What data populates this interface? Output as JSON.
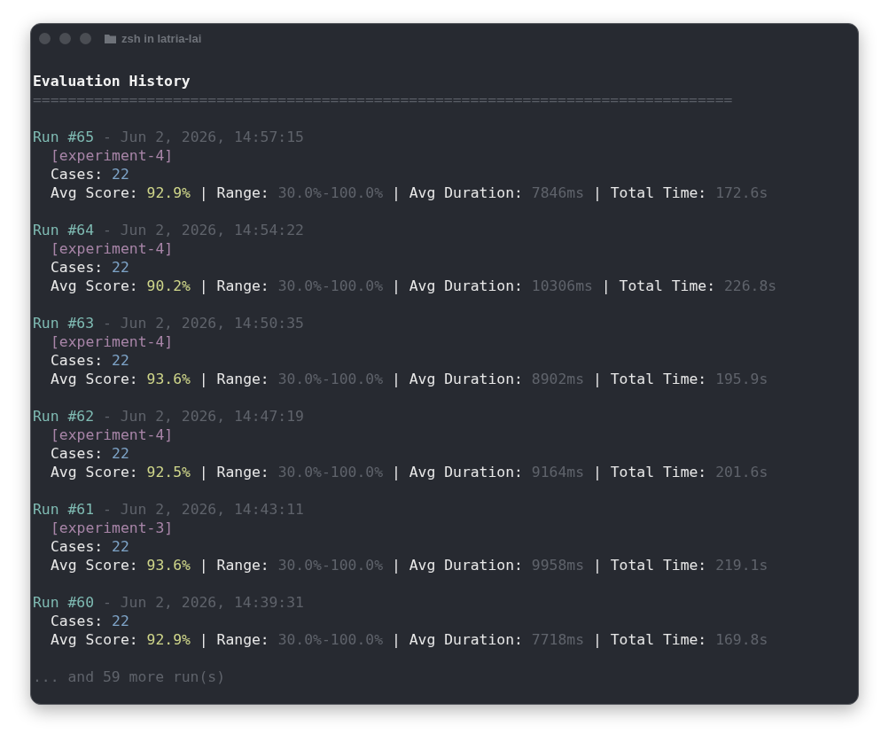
{
  "window": {
    "title": "zsh in latria-lai"
  },
  "heading": "Evaluation History",
  "rule": "================================================================================",
  "runs": [
    {
      "run": "Run #65",
      "timestamp": "- Jun 2, 2026, 14:57:15",
      "tag": "[experiment-4]",
      "cases_label": "Cases:",
      "cases": "22",
      "stats": [
        {
          "label": "Avg Score:",
          "value": "92.9%",
          "kind": "score"
        },
        {
          "sep": "|",
          "label": "Range:",
          "value": "30.0%-100.0%",
          "kind": "muted"
        },
        {
          "sep": "|",
          "label": "Avg Duration:",
          "value": "7846ms",
          "kind": "muted"
        },
        {
          "sep": "|",
          "label": "Total Time:",
          "value": "172.6s",
          "kind": "muted"
        }
      ]
    },
    {
      "run": "Run #64",
      "timestamp": "- Jun 2, 2026, 14:54:22",
      "tag": "[experiment-4]",
      "cases_label": "Cases:",
      "cases": "22",
      "stats": [
        {
          "label": "Avg Score:",
          "value": "90.2%",
          "kind": "score"
        },
        {
          "sep": "|",
          "label": "Range:",
          "value": "30.0%-100.0%",
          "kind": "muted"
        },
        {
          "sep": "|",
          "label": "Avg Duration:",
          "value": "10306ms",
          "kind": "muted"
        },
        {
          "sep": "|",
          "label": "Total Time:",
          "value": "226.8s",
          "kind": "muted"
        }
      ]
    },
    {
      "run": "Run #63",
      "timestamp": "- Jun 2, 2026, 14:50:35",
      "tag": "[experiment-4]",
      "cases_label": "Cases:",
      "cases": "22",
      "stats": [
        {
          "label": "Avg Score:",
          "value": "93.6%",
          "kind": "score"
        },
        {
          "sep": "|",
          "label": "Range:",
          "value": "30.0%-100.0%",
          "kind": "muted"
        },
        {
          "sep": "|",
          "label": "Avg Duration:",
          "value": "8902ms",
          "kind": "muted"
        },
        {
          "sep": "|",
          "label": "Total Time:",
          "value": "195.9s",
          "kind": "muted"
        }
      ]
    },
    {
      "run": "Run #62",
      "timestamp": "- Jun 2, 2026, 14:47:19",
      "tag": "[experiment-4]",
      "cases_label": "Cases:",
      "cases": "22",
      "stats": [
        {
          "label": "Avg Score:",
          "value": "92.5%",
          "kind": "score"
        },
        {
          "sep": "|",
          "label": "Range:",
          "value": "30.0%-100.0%",
          "kind": "muted"
        },
        {
          "sep": "|",
          "label": "Avg Duration:",
          "value": "9164ms",
          "kind": "muted"
        },
        {
          "sep": "|",
          "label": "Total Time:",
          "value": "201.6s",
          "kind": "muted"
        }
      ]
    },
    {
      "run": "Run #61",
      "timestamp": "- Jun 2, 2026, 14:43:11",
      "tag": "[experiment-3]",
      "cases_label": "Cases:",
      "cases": "22",
      "stats": [
        {
          "label": "Avg Score:",
          "value": "93.6%",
          "kind": "score"
        },
        {
          "sep": "|",
          "label": "Range:",
          "value": "30.0%-100.0%",
          "kind": "muted"
        },
        {
          "sep": "|",
          "label": "Avg Duration:",
          "value": "9958ms",
          "kind": "muted"
        },
        {
          "sep": "|",
          "label": "Total Time:",
          "value": "219.1s",
          "kind": "muted"
        }
      ]
    },
    {
      "run": "Run #60",
      "timestamp": "- Jun 2, 2026, 14:39:31",
      "cases_label": "Cases:",
      "cases": "22",
      "stats": [
        {
          "label": "Avg Score:",
          "value": "92.9%",
          "kind": "score"
        },
        {
          "sep": "|",
          "label": "Range:",
          "value": "30.0%-100.0%",
          "kind": "muted"
        },
        {
          "sep": "|",
          "label": "Avg Duration:",
          "value": "7718ms",
          "kind": "muted"
        },
        {
          "sep": "|",
          "label": "Total Time:",
          "value": "169.8s",
          "kind": "muted"
        }
      ]
    }
  ],
  "footer": "... and 59 more run(s)"
}
